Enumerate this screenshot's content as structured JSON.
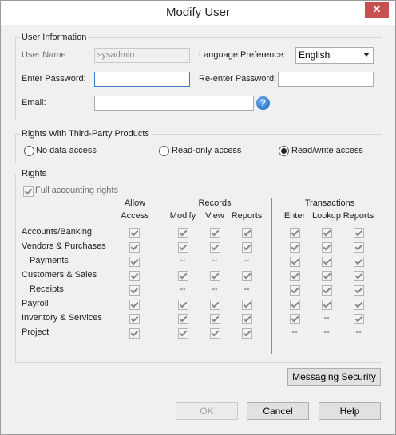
{
  "window": {
    "title": "Modify User",
    "close_glyph": "✕"
  },
  "user_info": {
    "group_label": "User Information",
    "user_name_label": "User Name:",
    "user_name_value": "sysadmin",
    "language_label": "Language Preference:",
    "language_value": "English",
    "password_label": "Enter Password:",
    "password_value": "",
    "reenter_label": "Re-enter Password:",
    "reenter_value": "",
    "email_label": "Email:",
    "email_value": "",
    "help_glyph": "?"
  },
  "third_party": {
    "group_label": "Rights With Third-Party Products",
    "options": [
      "No data access",
      "Read-only access",
      "Read/write access"
    ],
    "selected": "Read/write access"
  },
  "rights": {
    "group_label": "Rights",
    "full_accounting_label": "Full accounting rights",
    "full_accounting_checked": true,
    "headers": {
      "allow_line1": "Allow",
      "allow_line2": "Access",
      "records": "Records",
      "transactions": "Transactions",
      "modify": "Modify",
      "view": "View",
      "reports": "Reports",
      "enter": "Enter",
      "lookup": "Lookup",
      "t_reports": "Reports"
    },
    "rows": [
      {
        "label": "Accounts/Banking",
        "cells": [
          "check",
          "check",
          "check",
          "check",
          "check",
          "check",
          "check"
        ]
      },
      {
        "label": "Vendors & Purchases",
        "cells": [
          "check",
          "check",
          "check",
          "check",
          "check",
          "check",
          "check"
        ]
      },
      {
        "label": "Payments",
        "cells": [
          "check",
          "--",
          "--",
          "--",
          "check",
          "check",
          "check"
        ]
      },
      {
        "label": "Customers & Sales",
        "cells": [
          "check",
          "check",
          "check",
          "check",
          "check",
          "check",
          "check"
        ]
      },
      {
        "label": "Receipts",
        "cells": [
          "check",
          "--",
          "--",
          "--",
          "check",
          "check",
          "check"
        ]
      },
      {
        "label": "Payroll",
        "cells": [
          "check",
          "check",
          "check",
          "check",
          "check",
          "check",
          "check"
        ]
      },
      {
        "label": "Inventory & Services",
        "cells": [
          "check",
          "check",
          "check",
          "check",
          "check",
          "--",
          "check"
        ]
      },
      {
        "label": "Project",
        "cells": [
          "check",
          "check",
          "check",
          "check",
          "--",
          "--",
          "--"
        ]
      }
    ]
  },
  "buttons": {
    "messaging_security": "Messaging Security",
    "ok": "OK",
    "cancel": "Cancel",
    "help": "Help"
  }
}
